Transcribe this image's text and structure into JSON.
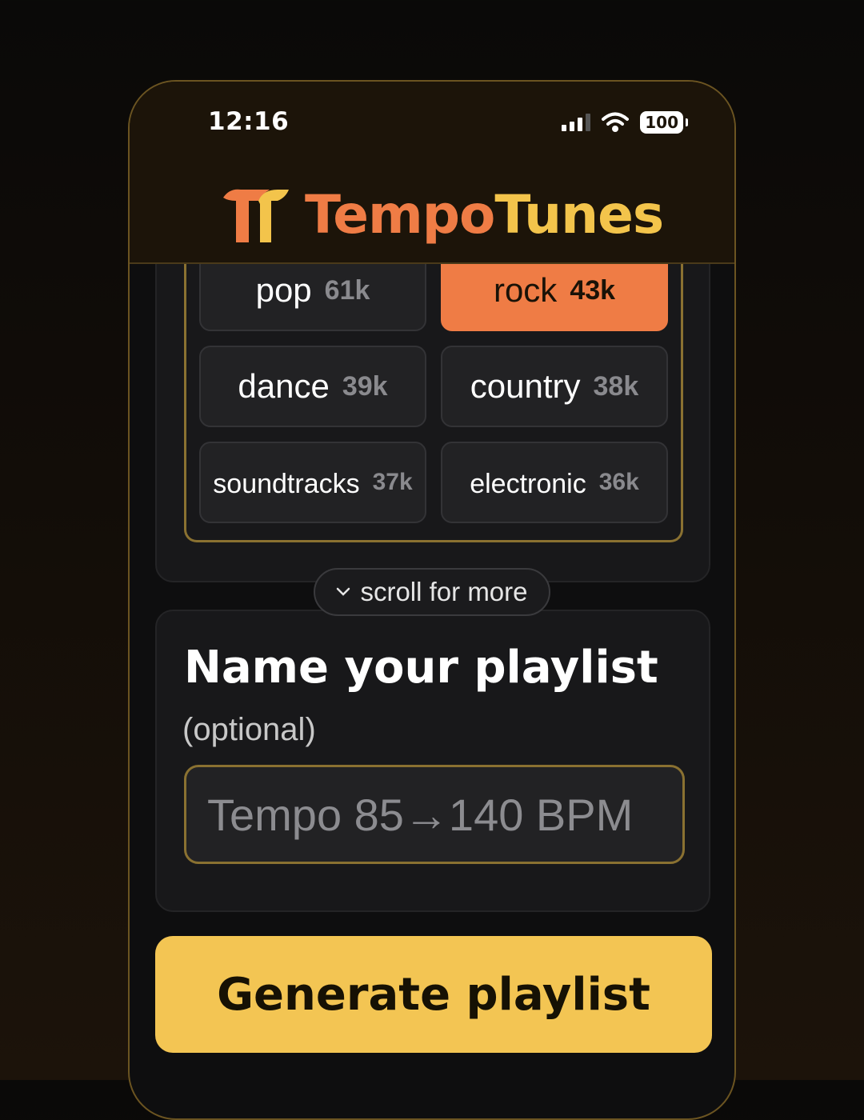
{
  "status_bar": {
    "time": "12:16",
    "battery": "100"
  },
  "brand": {
    "name_part1": "Tempo",
    "name_part2": "Tunes"
  },
  "genres": [
    {
      "name": "pop",
      "count": "61k",
      "selected": false
    },
    {
      "name": "rock",
      "count": "43k",
      "selected": true
    },
    {
      "name": "dance",
      "count": "39k",
      "selected": false
    },
    {
      "name": "country",
      "count": "38k",
      "selected": false
    },
    {
      "name": "soundtracks",
      "count": "37k",
      "selected": false
    },
    {
      "name": "electronic",
      "count": "36k",
      "selected": false
    }
  ],
  "scroll_hint": "scroll for more",
  "name_section": {
    "title": "Name your playlist",
    "subtitle": "(optional)",
    "placeholder": "Tempo 85→140 BPM"
  },
  "generate_button": "Generate playlist",
  "colors": {
    "accent_orange": "#ef7c45",
    "accent_yellow": "#f3c553",
    "frame_gold": "#8a7131"
  }
}
